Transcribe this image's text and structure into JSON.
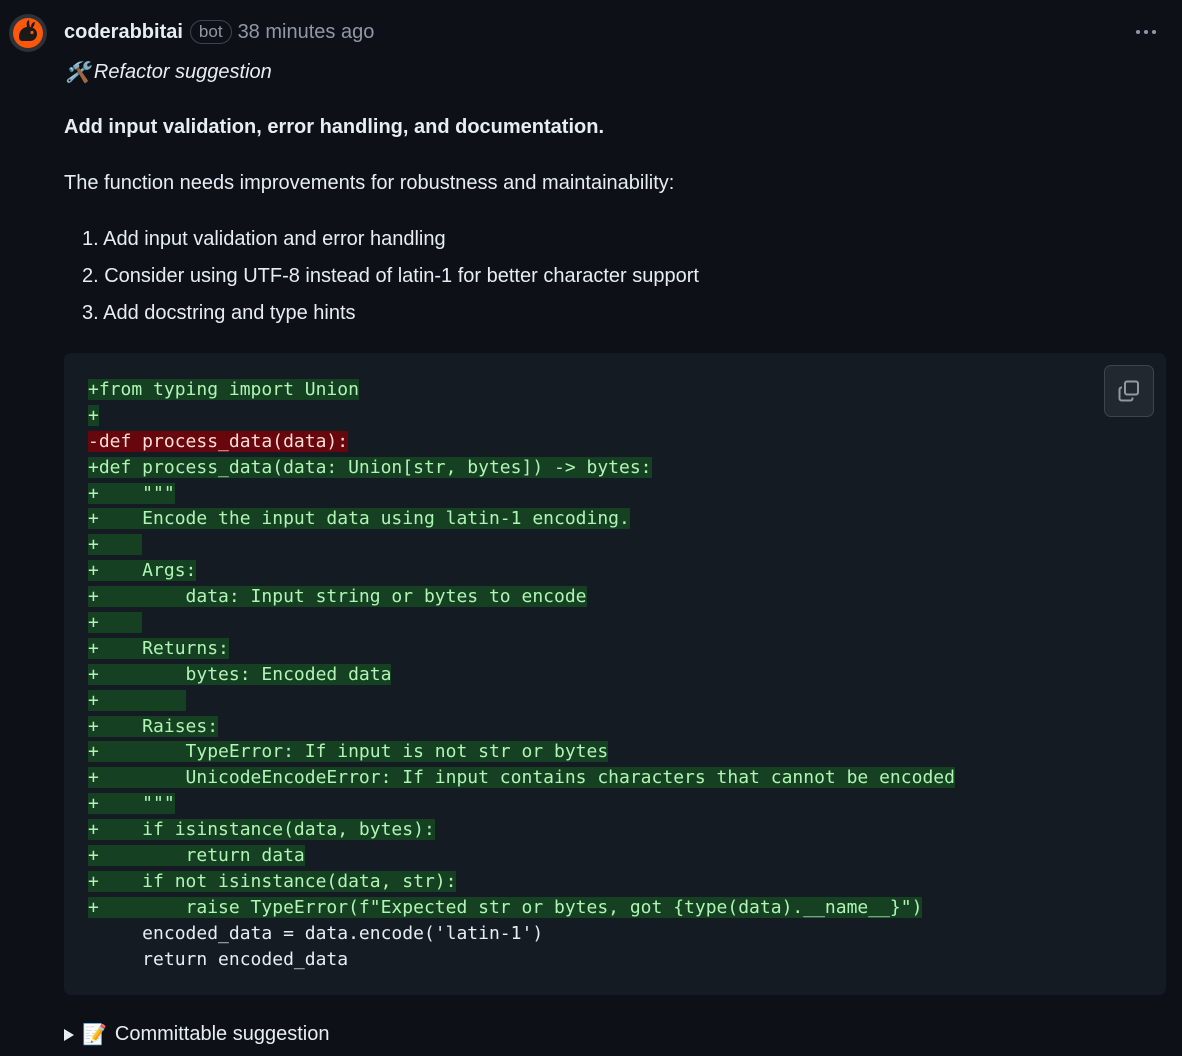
{
  "comment": {
    "author": "coderabbitai",
    "badge": "bot",
    "time": "38 minutes ago",
    "refactor_label": "Refactor suggestion",
    "refactor_emoji": "🛠️",
    "heading": "Add input validation, error handling, and documentation.",
    "intro": "The function needs improvements for robustness and maintainability:",
    "steps": [
      "1. Add input validation and error handling",
      "2. Consider using UTF-8 instead of latin-1 for better character support",
      "3. Add docstring and type hints"
    ],
    "code_lines": [
      {
        "type": "add",
        "text": "+from typing import Union"
      },
      {
        "type": "add",
        "text": "+"
      },
      {
        "type": "del",
        "text": "-def process_data(data):"
      },
      {
        "type": "add",
        "text": "+def process_data(data: Union[str, bytes]) -> bytes:"
      },
      {
        "type": "add",
        "text": "+    \"\"\""
      },
      {
        "type": "add",
        "text": "+    Encode the input data using latin-1 encoding."
      },
      {
        "type": "add",
        "text": "+    "
      },
      {
        "type": "add",
        "text": "+    Args:"
      },
      {
        "type": "add",
        "text": "+        data: Input string or bytes to encode"
      },
      {
        "type": "add",
        "text": "+    "
      },
      {
        "type": "add",
        "text": "+    Returns:"
      },
      {
        "type": "add",
        "text": "+        bytes: Encoded data"
      },
      {
        "type": "add",
        "text": "+        "
      },
      {
        "type": "add",
        "text": "+    Raises:"
      },
      {
        "type": "add",
        "text": "+        TypeError: If input is not str or bytes"
      },
      {
        "type": "add",
        "text": "+        UnicodeEncodeError: If input contains characters that cannot be encoded"
      },
      {
        "type": "add",
        "text": "+    \"\"\""
      },
      {
        "type": "add",
        "text": "+    if isinstance(data, bytes):"
      },
      {
        "type": "add",
        "text": "+        return data"
      },
      {
        "type": "add",
        "text": "+    if not isinstance(data, str):"
      },
      {
        "type": "add",
        "text": "+        raise TypeError(f\"Expected str or bytes, got {type(data).__name__}\")"
      },
      {
        "type": "ctx",
        "text": "     encoded_data = data.encode('latin-1')"
      },
      {
        "type": "ctx",
        "text": "     return encoded_data"
      }
    ],
    "committable_label": "Committable suggestion",
    "committable_emoji": "📝"
  },
  "icons": {
    "avatar": "coderabbit-logo-icon",
    "menu": "kebab-menu-icon",
    "copy": "copy-icon",
    "expand": "disclosure-triangle-icon"
  },
  "colors": {
    "background": "#0d1117",
    "code_background": "#151b23",
    "added_background": "#154021",
    "added_text": "#aff5b4",
    "deleted_background": "#67060c",
    "deleted_text": "#ffdcd7",
    "avatar_orange": "#ff570a"
  }
}
